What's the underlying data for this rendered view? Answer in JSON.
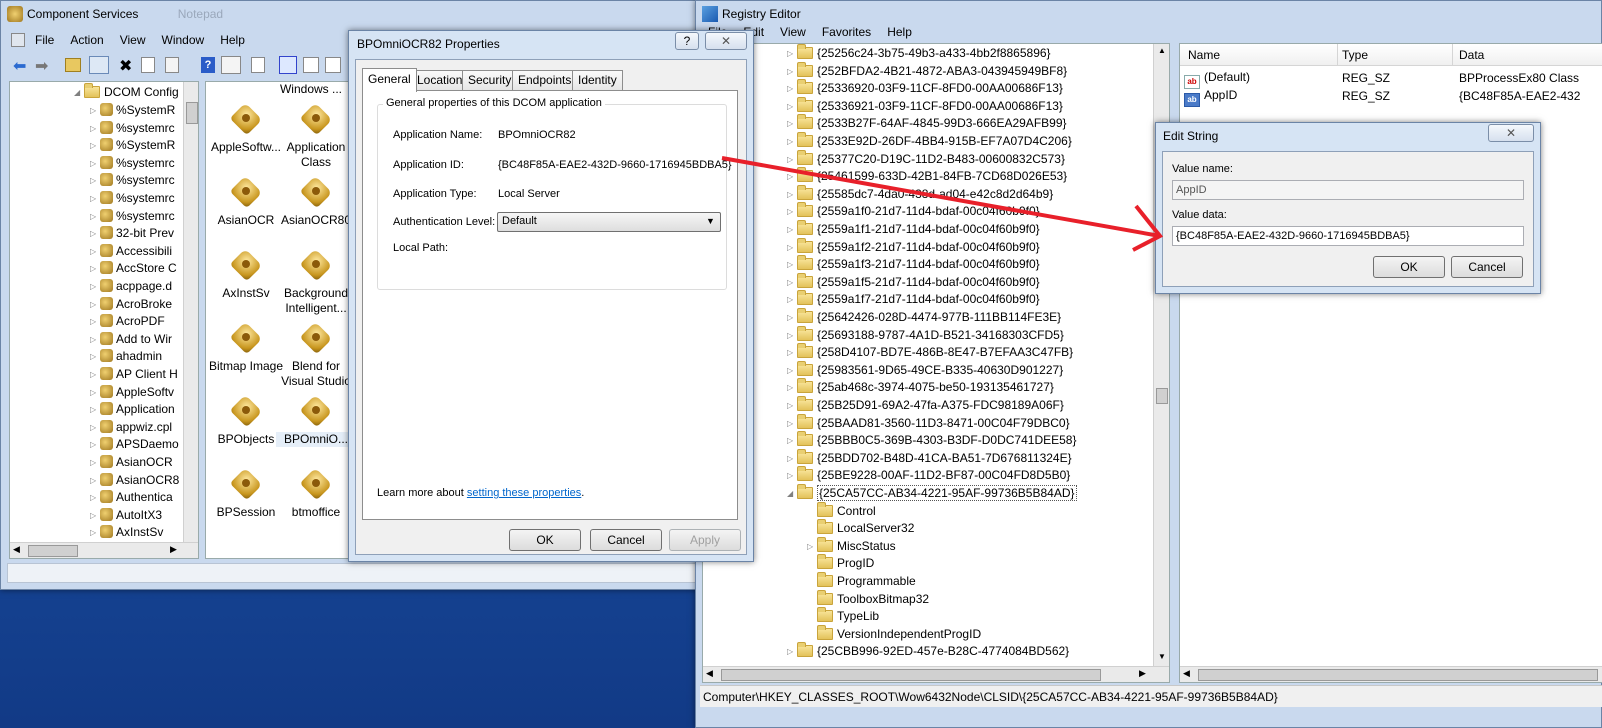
{
  "component_services": {
    "title": "Component Services",
    "ghost_title": "Notepad",
    "menu": [
      "File",
      "Action",
      "View",
      "Window",
      "Help"
    ],
    "tree_root": "DCOM Config",
    "tree_items": [
      "%SystemR",
      "%systemrc",
      "%SystemR",
      "%systemrc",
      "%systemrc",
      "%systemrc",
      "%systemrc",
      "32-bit Prev",
      "Accessibili",
      "AccStore C",
      "acppage.d",
      "AcroBroke",
      "AcroPDF",
      "Add to Wir",
      "ahadmin",
      "AP Client H",
      "AppleSoftv",
      "Application",
      "appwiz.cpl",
      "APSDaemo",
      "AsianOCR",
      "AsianOCR8",
      "Authentica",
      "AutoItX3",
      "AxInstSv"
    ],
    "icons_top_label": "Windows ...",
    "icons": [
      [
        "AppleSoftw...",
        "Application Class"
      ],
      [
        "AsianOCR",
        "AsianOCR80"
      ],
      [
        "AxInstSv",
        "Background Intelligent..."
      ],
      [
        "Bitmap Image",
        "Blend for Visual Studio"
      ],
      [
        "BPObjects",
        "BPOmniO..."
      ],
      [
        "BPSession",
        "btmoffice"
      ]
    ]
  },
  "properties_dialog": {
    "title": "BPOmniOCR82 Properties",
    "help_btn": "?",
    "close_btn": "✕",
    "tabs": [
      "General",
      "Location",
      "Security",
      "Endpoints",
      "Identity"
    ],
    "group_title": "General properties of this DCOM application",
    "app_name_label": "Application Name:",
    "app_name": "BPOmniOCR82",
    "app_id_label": "Application ID:",
    "app_id": "{BC48F85A-EAE2-432D-9660-1716945BDBA5}",
    "app_type_label": "Application Type:",
    "app_type": "Local Server",
    "auth_label": "Authentication Level:",
    "auth_value": "Default",
    "local_path_label": "Local Path:",
    "learn_more_text": "Learn more about",
    "learn_more_link": "setting these properties",
    "learn_more_end": ".",
    "ok": "OK",
    "cancel": "Cancel",
    "apply": "Apply"
  },
  "registry_editor": {
    "title": "Registry Editor",
    "menu": [
      "File",
      "Edit",
      "View",
      "Favorites",
      "Help"
    ],
    "keys": [
      "{25256c24-3b75-49b3-a433-4bb2f8865896}",
      "{252BFDA2-4B21-4872-ABA3-043945949BF8}",
      "{25336920-03F9-11CF-8FD0-00AA00686F13}",
      "{25336921-03F9-11CF-8FD0-00AA00686F13}",
      "{2533B27F-64AF-4845-99D3-666EA29AFB99}",
      "{2533E92D-26DF-4BB4-915B-EF7A07D4C206}",
      "{25377C20-D19C-11D2-B483-00600832C573}",
      "{25461599-633D-42B1-84FB-7CD68D026E53}",
      "{25585dc7-4da0-438d-ad04-e42c8d2d64b9}",
      "{2559a1f0-21d7-11d4-bdaf-00c04f60b9f0}",
      "{2559a1f1-21d7-11d4-bdaf-00c04f60b9f0}",
      "{2559a1f2-21d7-11d4-bdaf-00c04f60b9f0}",
      "{2559a1f3-21d7-11d4-bdaf-00c04f60b9f0}",
      "{2559a1f5-21d7-11d4-bdaf-00c04f60b9f0}",
      "{2559a1f7-21d7-11d4-bdaf-00c04f60b9f0}",
      "{25642426-028D-4474-977B-111BB114FE3E}",
      "{25693188-9787-4A1D-B521-34168303CFD5}",
      "{258D4107-BD7E-486B-8E47-B7EFAA3C47FB}",
      "{25983561-9D65-49CE-B335-40630D901227}",
      "{25ab468c-3974-4075-be50-193135461727}",
      "{25B25D91-69A2-47fa-A375-FDC98189A06F}",
      "{25BAAD81-3560-11D3-8471-00C04F79DBC0}",
      "{25BBB0C5-369B-4303-B3DF-D0DC741DEE58}",
      "{25BDD702-B48D-41CA-BA51-7D676811324E}",
      "{25BE9228-00AF-11D2-BF87-00C04FD8D5B0}",
      "{25CA57CC-AB34-4221-95AF-99736B5B84AD}"
    ],
    "subkeys": [
      "Control",
      "LocalServer32",
      "MiscStatus",
      "ProgID",
      "Programmable",
      "ToolboxBitmap32",
      "TypeLib",
      "VersionIndependentProgID"
    ],
    "after_key": "{25CBB996-92ED-457e-B28C-4774084BD562}",
    "columns": [
      "Name",
      "Type",
      "Data"
    ],
    "values": [
      {
        "name": "(Default)",
        "type": "REG_SZ",
        "data": "BPProcessEx80 Class"
      },
      {
        "name": "AppID",
        "type": "REG_SZ",
        "data": "{BC48F85A-EAE2-432"
      }
    ],
    "status": "Computer\\HKEY_CLASSES_ROOT\\Wow6432Node\\CLSID\\{25CA57CC-AB34-4221-95AF-99736B5B84AD}"
  },
  "edit_string": {
    "title": "Edit String",
    "value_name_label": "Value name:",
    "value_name": "AppID",
    "value_data_label": "Value data:",
    "value_data": "{BC48F85A-EAE2-432D-9660-1716945BDBA5}",
    "ok": "OK",
    "cancel": "Cancel"
  },
  "colors": {
    "desktop": "#1a56b0",
    "arrow": "#e8202a",
    "link": "#0066cc"
  }
}
